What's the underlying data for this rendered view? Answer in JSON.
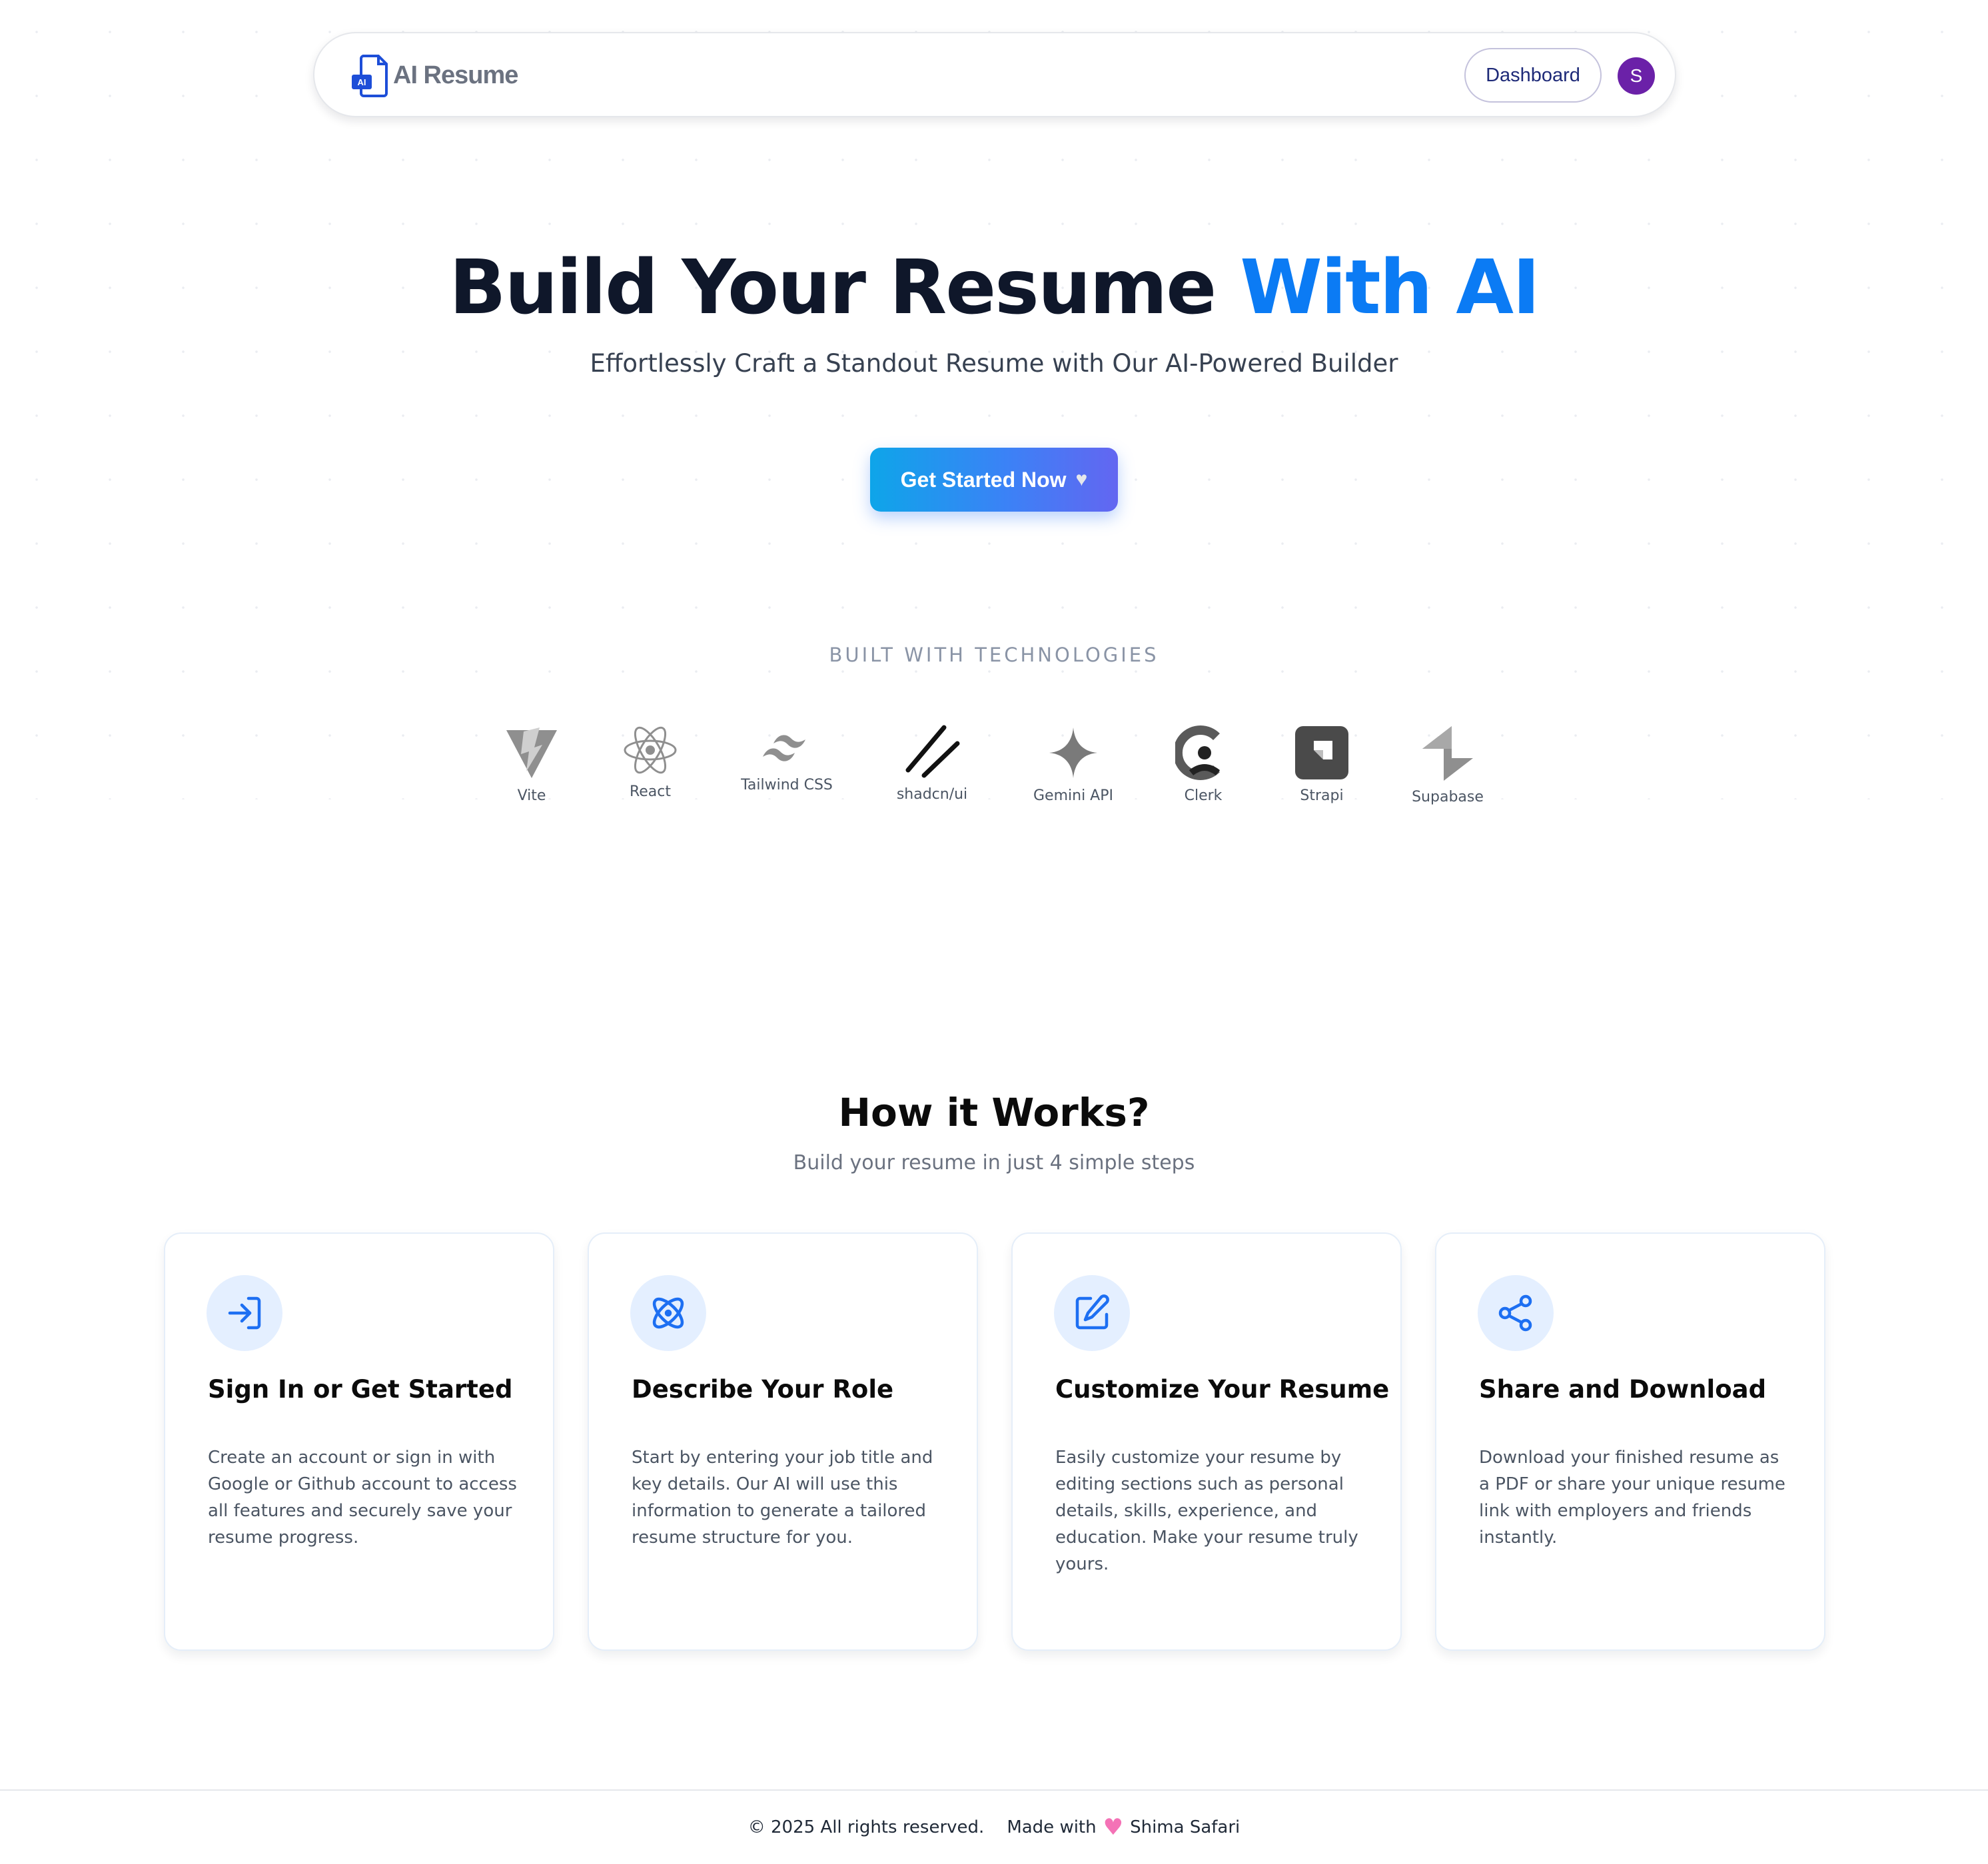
{
  "header": {
    "logo_badge": "AI",
    "logo_text": "AI Resume",
    "dashboard_label": "Dashboard",
    "avatar_initial": "S",
    "avatar_color": "#6b21a8"
  },
  "hero": {
    "title_main": "Build Your Resume ",
    "title_accent": "With AI",
    "accent_color": "#0b7bf4",
    "subtitle": "Effortlessly Craft a Standout Resume with Our AI-Powered Builder",
    "cta_label": "Get Started Now",
    "cta_icon": "heart-icon"
  },
  "tech": {
    "title": "BUILT WITH TECHNOLOGIES",
    "items": [
      {
        "label": "Vite",
        "icon": "vite-icon"
      },
      {
        "label": "React",
        "icon": "react-icon"
      },
      {
        "label": "Tailwind CSS",
        "icon": "tailwind-icon"
      },
      {
        "label": "shadcn/ui",
        "icon": "shadcn-icon"
      },
      {
        "label": "Gemini API",
        "icon": "gemini-icon"
      },
      {
        "label": "Clerk",
        "icon": "clerk-icon"
      },
      {
        "label": "Strapi",
        "icon": "strapi-icon"
      },
      {
        "label": "Supabase",
        "icon": "supabase-icon"
      }
    ]
  },
  "how": {
    "title": "How it Works?",
    "subtitle": "Build your resume in just 4 simple steps",
    "steps": [
      {
        "icon": "sign-in-icon",
        "title": "Sign In or Get Started",
        "description": "Create an account or sign in with Google or Github account to access all features and securely save your resume progress."
      },
      {
        "icon": "atom-icon",
        "title": "Describe Your Role",
        "description": "Start by entering your job title and key details. Our AI will use this information to generate a tailored resume structure for you."
      },
      {
        "icon": "edit-icon",
        "title": "Customize Your Resume",
        "description": "Easily customize your resume by editing sections such as personal details, skills, experience, and education. Make your resume truly yours."
      },
      {
        "icon": "share-icon",
        "title": "Share and Download",
        "description": "Download your finished resume as a PDF or share your unique resume link with employers and friends instantly."
      }
    ]
  },
  "footer": {
    "copyright": "© 2025 All rights reserved.",
    "made_with": "Made with",
    "author": "Shima Safari"
  }
}
